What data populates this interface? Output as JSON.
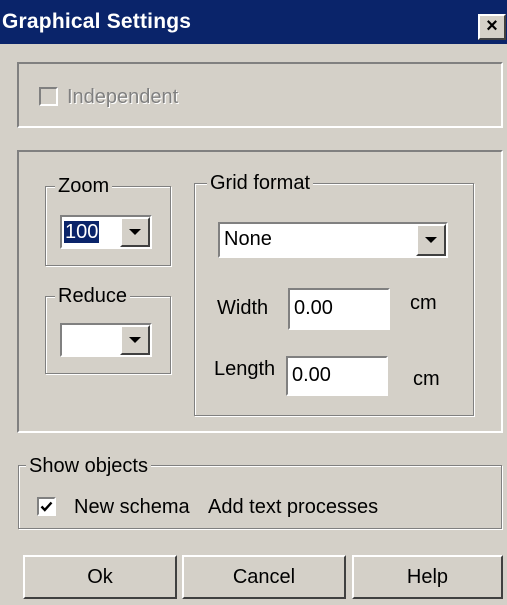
{
  "window": {
    "title": "Graphical Settings",
    "close_label": "×"
  },
  "independent": {
    "label": "Independent",
    "checked": false,
    "disabled": true
  },
  "zoom": {
    "legend": "Zoom",
    "value": "100"
  },
  "reduce": {
    "legend": "Reduce",
    "value": ""
  },
  "grid": {
    "legend": "Grid format",
    "format_value": "None",
    "width_label": "Width",
    "width_value": "0.00",
    "width_unit": "cm",
    "length_label": "Length",
    "length_value": "0.00",
    "length_unit": "cm"
  },
  "show_objects": {
    "legend": "Show objects",
    "new_schema_label": "New schema",
    "new_schema_checked": true,
    "add_text_label": "Add text processes"
  },
  "buttons": {
    "ok": "Ok",
    "cancel": "Cancel",
    "help": "Help"
  }
}
